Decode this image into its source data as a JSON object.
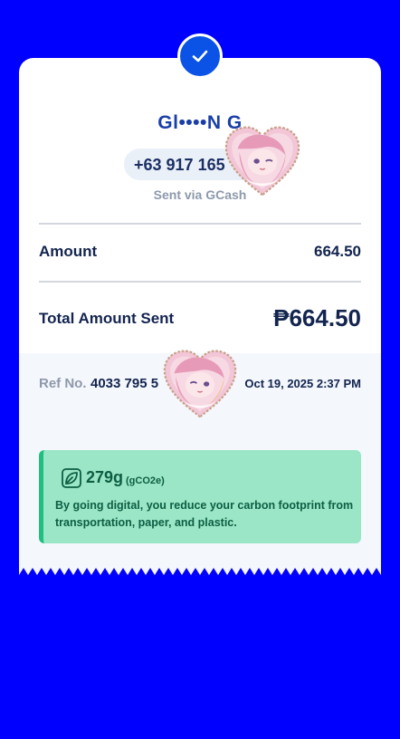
{
  "recipient": {
    "name": "Gl••••N G",
    "phone": "+63 917 165",
    "sent_via": "Sent via GCash"
  },
  "amount": {
    "label": "Amount",
    "value": "664.50"
  },
  "total": {
    "label": "Total Amount Sent",
    "currency": "₱",
    "value": "664.50"
  },
  "reference": {
    "label": "Ref No.",
    "number": "4033 795 5",
    "datetime": "Oct 19, 2025 2:37 PM"
  },
  "eco": {
    "icon": "leaf-icon",
    "amount": "279g",
    "unit": "(gCO2e)",
    "message": "By going digital, you reduce your carbon footprint from transportation, paper, and plastic."
  },
  "colors": {
    "background": "#0000ff",
    "accent": "#0a53e6",
    "eco_card": "#9ae6c7",
    "eco_border": "#1fbf7f"
  },
  "stickers": [
    "anime-heart-sticker",
    "anime-heart-sticker"
  ]
}
